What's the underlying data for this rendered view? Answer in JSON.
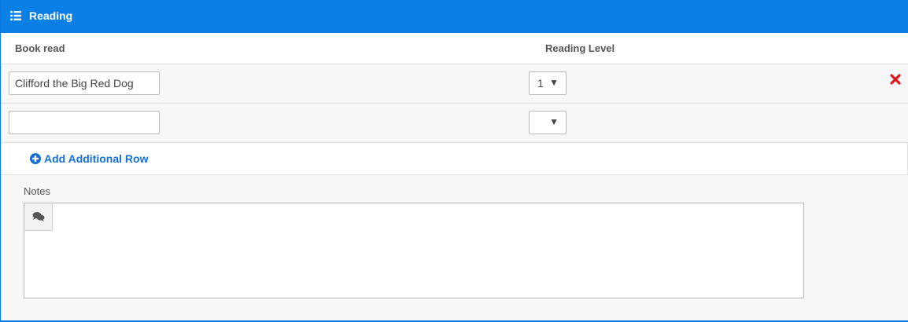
{
  "section": {
    "title": "Reading",
    "icon": "list-icon",
    "accent_color": "#0a80e6"
  },
  "columns": {
    "book": "Book read",
    "level": "Reading Level"
  },
  "rows": [
    {
      "book_value": "Clifford the Big Red Dog",
      "level_value": "1",
      "delete_icon": "x-icon"
    },
    {
      "book_value": "",
      "level_value": ""
    }
  ],
  "add_row": {
    "label": "Add Additional Row",
    "icon": "plus-circle-icon"
  },
  "notes": {
    "label": "Notes",
    "value": "",
    "toolbar_icon": "comments-icon"
  }
}
